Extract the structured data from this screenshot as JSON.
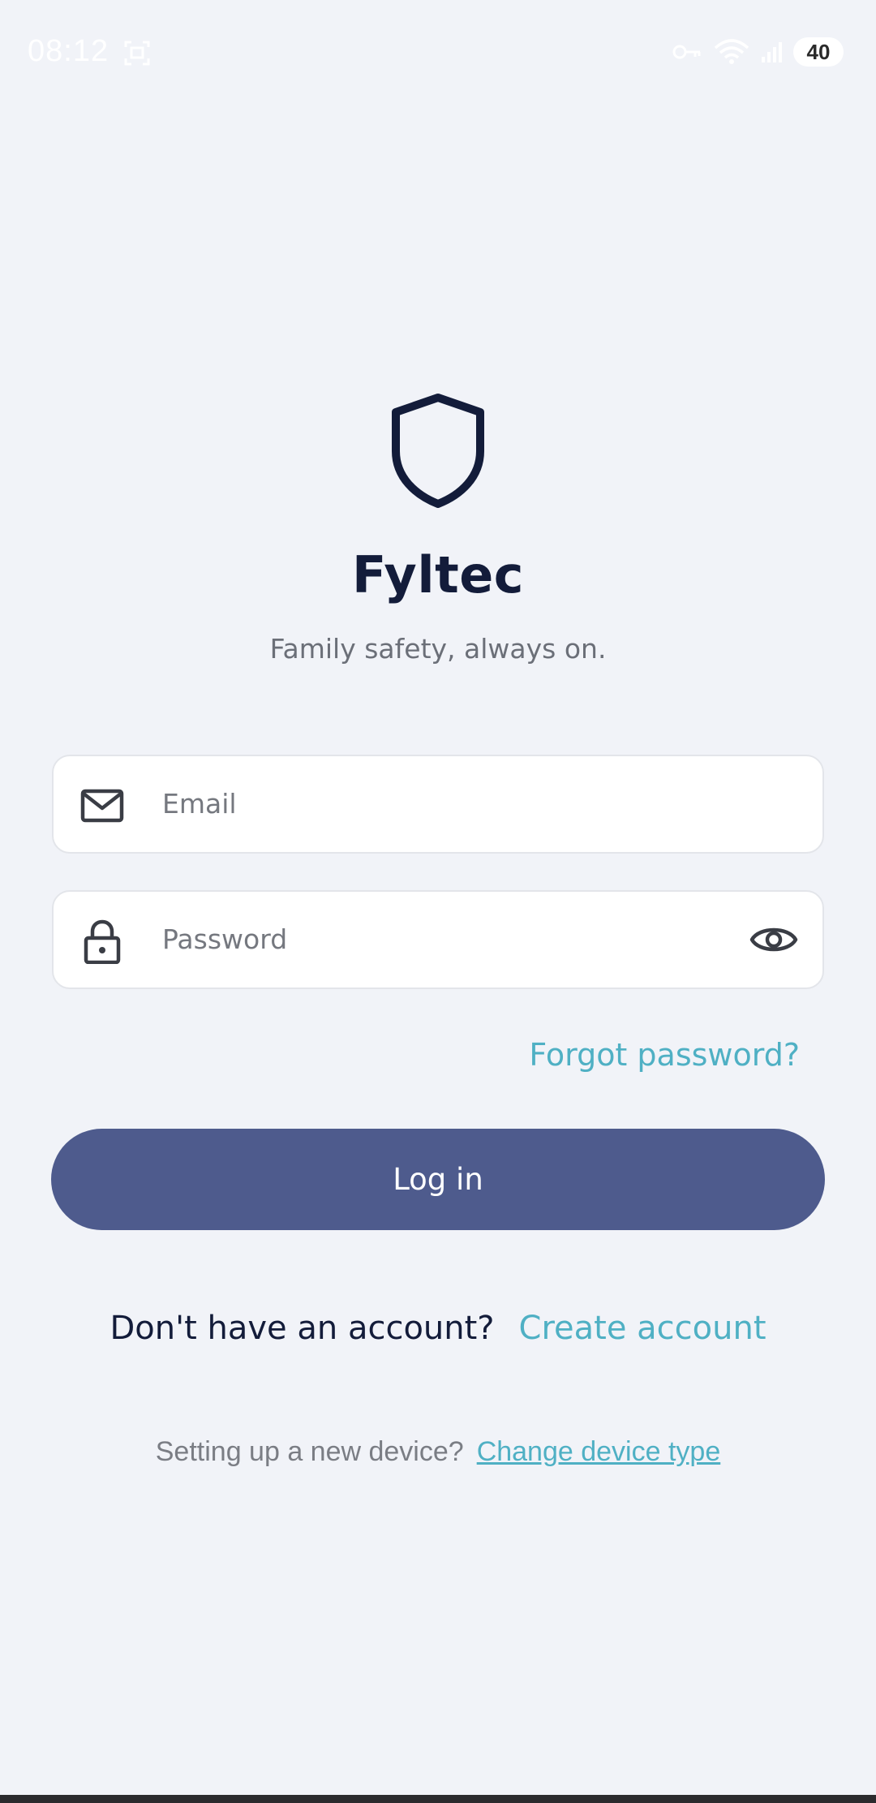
{
  "status_bar": {
    "time": "08:12",
    "battery": "40"
  },
  "app": {
    "name": "Fyltec",
    "tagline": "Family safety, always on."
  },
  "login_form": {
    "email_placeholder": "Email",
    "password_placeholder": "Password",
    "forgot_password": "Forgot password?",
    "login_button": "Log in"
  },
  "signup": {
    "prompt": "Don't have an account?",
    "link": "Create account"
  },
  "device": {
    "prompt": "Setting up a new device?",
    "link": "Change device type"
  },
  "icons": {
    "email": "mail-icon",
    "password": "lock-icon",
    "toggle_visibility": "eye-icon",
    "logo": "shield-icon"
  },
  "colors": {
    "background": "#f1f3f8",
    "primary_button": "#4e5b8d",
    "accent_link": "#4fb0c4",
    "title_text": "#131c3a"
  }
}
